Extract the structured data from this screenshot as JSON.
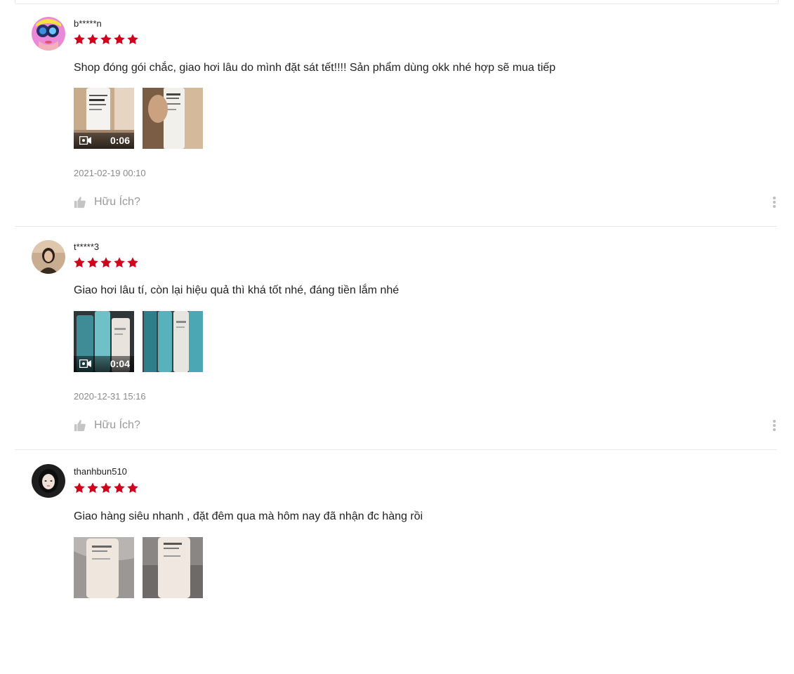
{
  "rating_color": "#d0011b",
  "icons": {
    "star": "star-icon",
    "video": "video-camera-icon",
    "like": "thumbs-up-icon",
    "more": "more-vertical-icon"
  },
  "reviews": [
    {
      "username": "b*****n",
      "rating": 5,
      "comment": "Shop đóng gói chắc, giao hơi lâu do mình đặt sát tết!!!! Sản phẩm dùng okk nhé hợp sẽ mua tiếp",
      "video_duration": "0:06",
      "timestamp": "2021-02-19 00:10",
      "helpful_label": "Hữu Ích?"
    },
    {
      "username": "t*****3",
      "rating": 5,
      "comment": "Giao hơi lâu tí, còn lại hiệu quả thì khá tốt nhé, đáng tiền lắm nhé",
      "video_duration": "0:04",
      "timestamp": "2020-12-31 15:16",
      "helpful_label": "Hữu Ích?"
    },
    {
      "username": "thanhbun510",
      "rating": 5,
      "comment": "Giao hàng siêu nhanh , đặt đêm qua mà hôm nay đã nhận đc hàng rồi"
    }
  ]
}
